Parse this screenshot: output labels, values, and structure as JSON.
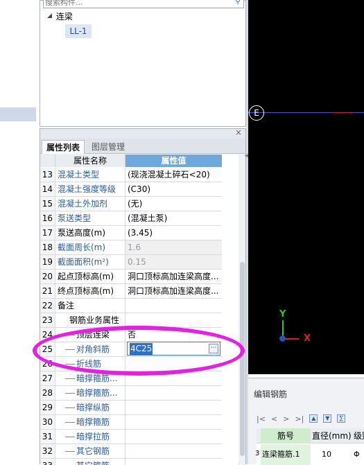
{
  "tree": {
    "search_placeholder": "搜索构件...",
    "root_label": "连梁",
    "child_label": "LL-1"
  },
  "props": {
    "tabs": [
      "属性列表",
      "图层管理"
    ],
    "col_name": "属性名称",
    "col_value": "属性值",
    "rows": [
      {
        "n": "13",
        "name": "混凝土类型",
        "value": "(现浇混凝土碎石<20)",
        "style": "blue"
      },
      {
        "n": "14",
        "name": "混凝土强度等级",
        "value": "(C30)",
        "style": "blue"
      },
      {
        "n": "15",
        "name": "混凝土外加剂",
        "value": "(无)",
        "style": "blue"
      },
      {
        "n": "16",
        "name": "泵送类型",
        "value": "(混凝土泵)",
        "style": "blue"
      },
      {
        "n": "17",
        "name": "泵送高度(m)",
        "value": "(3.45)",
        "style": "black"
      },
      {
        "n": "18",
        "name": "截面周长(m)",
        "value": "1.6",
        "style": "grey"
      },
      {
        "n": "19",
        "name": "截面面积(m²)",
        "value": "0.15",
        "style": "grey"
      },
      {
        "n": "20",
        "name": "起点顶标高(m)",
        "value": "洞口顶标高加连梁高度...",
        "style": "black"
      },
      {
        "n": "21",
        "name": "终点顶标高(m)",
        "value": "洞口顶标高加连梁高度...",
        "style": "black"
      },
      {
        "n": "22",
        "name": "备注",
        "value": "",
        "style": "black"
      },
      {
        "n": "23",
        "name": "钢筋业务属性",
        "value": "",
        "style": "group"
      },
      {
        "n": "24",
        "name": "顶层连梁",
        "value": "否",
        "style": "subblack"
      },
      {
        "n": "25",
        "name": "对角斜筋",
        "value": "4C25",
        "style": "subblue"
      },
      {
        "n": "26",
        "name": "折线筋",
        "value": "",
        "style": "subblue"
      },
      {
        "n": "27",
        "name": "暗撑箍筋...",
        "value": "",
        "style": "subblue"
      },
      {
        "n": "28",
        "name": "暗撑箍筋...",
        "value": "",
        "style": "subblue"
      },
      {
        "n": "29",
        "name": "暗撑纵筋",
        "value": "",
        "style": "subblue"
      },
      {
        "n": "30",
        "name": "暗撑箍筋",
        "value": "",
        "style": "subblue"
      },
      {
        "n": "31",
        "name": "暗撑拉筋",
        "value": "",
        "style": "subblue"
      },
      {
        "n": "32",
        "name": "其它钢筋",
        "value": "",
        "style": "subblue"
      },
      {
        "n": "33",
        "name": "其它箍筋",
        "value": "",
        "style": "subblue"
      }
    ]
  },
  "canvas": {
    "e_label": "E",
    "axis_y": "Y",
    "axis_x": "X"
  },
  "rebar": {
    "title": "编辑钢筋",
    "toolbar": [
      "|<",
      "<",
      ">",
      ">|"
    ],
    "col_no": "筋号",
    "col_dia": "直径(mm)",
    "col_grade": "级别",
    "row_index": "3",
    "row_name": "连梁箍筋.1",
    "row_dia": "10",
    "row_grade": "Φ"
  },
  "colors": {
    "highlight_ellipse": "#e61ee6",
    "header_value_bg": "#6ea8dc",
    "canvas_bg": "#000000"
  }
}
